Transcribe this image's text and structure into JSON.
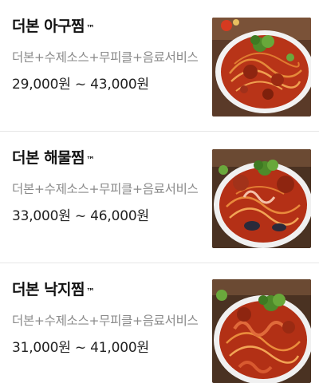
{
  "menu": {
    "items": [
      {
        "name": "더본 아구찜",
        "tm": "™",
        "description": "더본+수제소스+무피클+음료서비스",
        "price": "29,000원 ~ 43,000원",
        "image": "braised-monkfish-dish"
      },
      {
        "name": "더본 해물찜",
        "tm": "™",
        "description": "더본+수제소스+무피클+음료서비스",
        "price": "33,000원 ~ 46,000원",
        "image": "braised-seafood-dish"
      },
      {
        "name": "더본 낙지찜",
        "tm": "™",
        "description": "더본+수제소스+무피클+음료서비스",
        "price": "31,000원 ~ 41,000원",
        "image": "braised-octopus-dish"
      }
    ]
  },
  "colors": {
    "title": "#111111",
    "description": "#8a8a8a",
    "price": "#222222",
    "divider": "#e6e6e6",
    "sauce": "#c0391b"
  }
}
